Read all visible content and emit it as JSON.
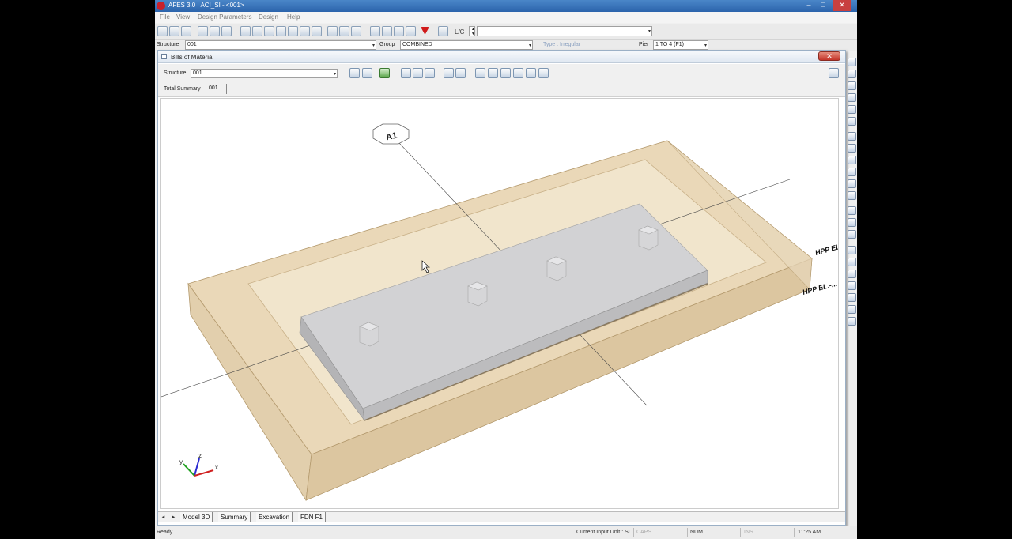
{
  "app": {
    "title": "AFES 3.0 : ACI_SI - <001>",
    "window_controls": {
      "minimize": "–",
      "maximize": "□",
      "close": "✕"
    }
  },
  "menu": [
    "File",
    "View",
    "Design Parameters",
    "Design",
    "Help"
  ],
  "toolbar": {
    "lc_label": "L/C",
    "lc_value": ""
  },
  "structure_row": {
    "structure_label": "Structure",
    "structure_value": "001",
    "group_label": "Group",
    "group_value": "COMBINED",
    "type_label": "Type : Irregular",
    "pier_label": "Pier",
    "pier_value": "1 TO 4 (F1)"
  },
  "child_window": {
    "title": "Bills of Material",
    "close": "✕",
    "structure_label": "Structure",
    "structure_value": "001",
    "total_summary_label": "Total Summary",
    "total_summary_value": "001"
  },
  "viewport": {
    "gridline_label": "A1",
    "elevation_labels": [
      "HPP EL...",
      "HPP EL.-..."
    ],
    "axis_labels": {
      "x": "x",
      "y": "y",
      "z": "z"
    },
    "excavation_color": "#e5d3b2",
    "footing_color": "#c6c6c8"
  },
  "tabs": {
    "nav_prev": "◄",
    "nav_next": "►",
    "items": [
      "Model 3D",
      "Summary",
      "Excavation",
      "FDN F1"
    ]
  },
  "statusbar": {
    "ready": "Ready",
    "input_unit": "Current Input Unit : SI",
    "caps": "CAPS",
    "num": "NUM",
    "ins": "INS",
    "time": "11:25 AM"
  }
}
